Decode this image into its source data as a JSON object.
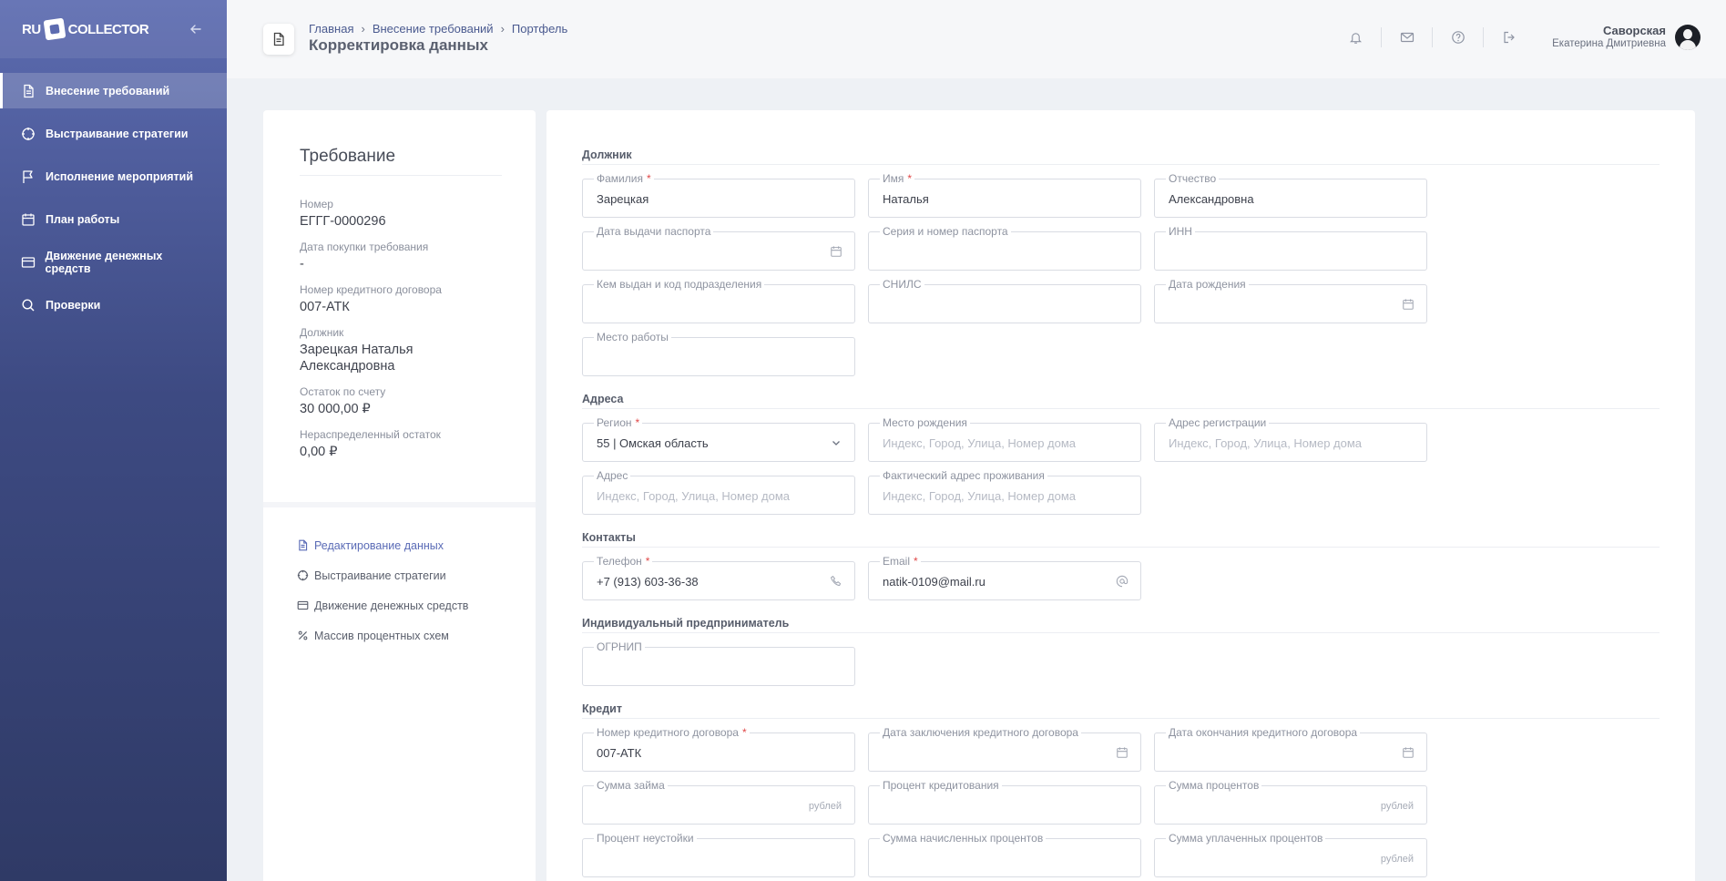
{
  "app": {
    "logo_left": "RU",
    "logo_right": "COLLECTOR"
  },
  "sidebar": {
    "items": [
      {
        "label": "Внесение требований",
        "icon": "document-icon"
      },
      {
        "label": "Выстраивание стратегии",
        "icon": "crosshair-icon"
      },
      {
        "label": "Исполнение мероприятий",
        "icon": "flag-icon"
      },
      {
        "label": "План работы",
        "icon": "calendar-icon"
      },
      {
        "label": "Движение денежных средств",
        "icon": "card-icon"
      },
      {
        "label": "Проверки",
        "icon": "search-icon"
      }
    ]
  },
  "header": {
    "breadcrumb": [
      "Главная",
      "Внесение требований",
      "Портфель"
    ],
    "title": "Корректировка данных",
    "user": {
      "last_name": "Саворская",
      "first_name": "Екатерина Дмитриевна"
    }
  },
  "claim": {
    "title": "Требование",
    "fields": [
      {
        "label": "Номер",
        "value": "ЕГГГ-0000296"
      },
      {
        "label": "Дата покупки требования",
        "value": "-"
      },
      {
        "label": "Номер кредитного договора",
        "value": "007-АТК"
      },
      {
        "label": "Должник",
        "value": "Зарецкая Наталья Александровна"
      },
      {
        "label": "Остаток по счету",
        "value": "30 000,00 ₽"
      },
      {
        "label": "Нераспределенный остаток",
        "value": "0,00 ₽"
      }
    ],
    "menu": [
      {
        "label": "Редактирование данных",
        "icon": "edit-document-icon"
      },
      {
        "label": "Выстраивание стратегии",
        "icon": "crosshair-icon"
      },
      {
        "label": "Движение денежных средств",
        "icon": "card-icon"
      },
      {
        "label": "Массив процентных схем",
        "icon": "percent-icon"
      }
    ]
  },
  "form": {
    "sections": {
      "debtor": "Должник",
      "addresses": "Адреса",
      "contacts": "Контакты",
      "ip": "Индивидуальный предприниматель",
      "credit": "Кредит"
    },
    "debtor": {
      "last_name": {
        "label": "Фамилия",
        "value": "Зарецкая"
      },
      "first_name": {
        "label": "Имя",
        "value": "Наталья"
      },
      "patronymic": {
        "label": "Отчество",
        "value": "Александровна"
      },
      "passport_date": {
        "label": "Дата выдачи паспорта",
        "value": ""
      },
      "passport_number": {
        "label": "Серия и номер паспорта",
        "value": ""
      },
      "inn": {
        "label": "ИНН",
        "value": ""
      },
      "issued_by": {
        "label": "Кем выдан и код подразделения",
        "value": ""
      },
      "snils": {
        "label": "СНИЛС",
        "value": ""
      },
      "birth_date": {
        "label": "Дата рождения",
        "value": ""
      },
      "workplace": {
        "label": "Место работы",
        "value": ""
      }
    },
    "addresses": {
      "region": {
        "label": "Регион",
        "value": "55 | Омская область"
      },
      "birth_place": {
        "label": "Место рождения",
        "placeholder": "Индекс, Город, Улица, Номер дома"
      },
      "registration": {
        "label": "Адрес регистрации",
        "placeholder": "Индекс, Город, Улица, Номер дома"
      },
      "address": {
        "label": "Адрес",
        "placeholder": "Индекс, Город, Улица, Номер дома"
      },
      "actual": {
        "label": "Фактический адрес проживания",
        "placeholder": "Индекс, Город, Улица, Номер дома"
      }
    },
    "contacts": {
      "phone": {
        "label": "Телефон",
        "value": "+7 (913) 603-36-38"
      },
      "email": {
        "label": "Email",
        "value": "natik-0109@mail.ru"
      }
    },
    "ip": {
      "ogrnip": {
        "label": "ОГРНИП",
        "value": ""
      }
    },
    "credit": {
      "contract_number": {
        "label": "Номер кредитного договора",
        "value": "007-АТК"
      },
      "contract_date": {
        "label": "Дата заключения кредитного договора",
        "value": ""
      },
      "contract_end": {
        "label": "Дата окончания кредитного договора",
        "value": ""
      },
      "loan_sum": {
        "label": "Сумма займа",
        "suffix": "рублей"
      },
      "interest_rate": {
        "label": "Процент кредитования",
        "value": ""
      },
      "interest_sum": {
        "label": "Сумма процентов",
        "suffix": "рублей"
      },
      "penalty_rate": {
        "label": "Процент неустойки",
        "value": ""
      },
      "accrued_interest": {
        "label": "Сумма начисленных процентов",
        "value": ""
      },
      "paid_interest": {
        "label": "Сумма уплаченных процентов",
        "suffix": "рублей"
      }
    }
  }
}
